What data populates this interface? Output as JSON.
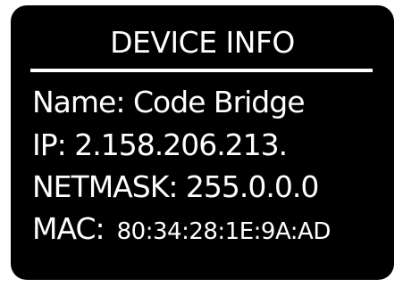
{
  "device_info": {
    "title": "DEVICE INFO",
    "name_line": "Name: Code Bridge",
    "ip_line": "IP: 2.158.206.213.",
    "netmask_line": "NETMASK: 255.0.0.0",
    "mac_label": "MAC:",
    "mac_value": "80:34:28:1E:9A:AD"
  },
  "colors": {
    "background": "#000000",
    "text": "#ffffff"
  }
}
